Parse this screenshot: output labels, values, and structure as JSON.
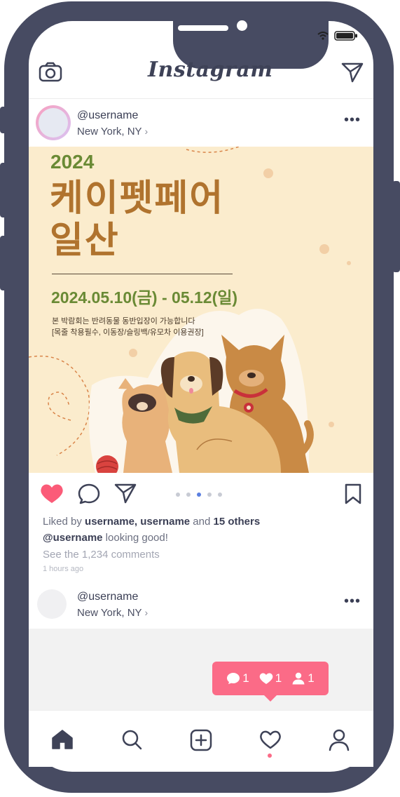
{
  "app": {
    "name": "Instagram"
  },
  "post": {
    "username": "@username",
    "location": "New York, NY",
    "image": {
      "year": "2024",
      "title_line1": "케이펫페어",
      "title_line2": "일산",
      "date": "2024.05.10(금) - 05.12(일)",
      "note_line1": "본 박람회는 반려동물 동반입장이 가능합니다",
      "note_line2": "[목줄 착용필수, 이동장/슬링백/유모차 이용권장]"
    },
    "carousel": {
      "count": 5,
      "active_index": 3
    },
    "liked": true,
    "likes": {
      "prefix": "Liked by",
      "users": "username, username",
      "connector": "and",
      "others": "15 others"
    },
    "caption": {
      "user": "@username",
      "text": "looking good!"
    },
    "comments_link": "See the 1,234 comments",
    "time": "1 hours ago"
  },
  "next_post": {
    "username": "@username",
    "location": "New York, NY"
  },
  "notification": {
    "comments": "1",
    "likes": "1",
    "follows": "1"
  },
  "tabs": [
    "home",
    "search",
    "add",
    "activity",
    "profile"
  ],
  "colors": {
    "frame": "#474b62",
    "accent": "#fb6b87",
    "active_dot": "#5b7fe0"
  }
}
